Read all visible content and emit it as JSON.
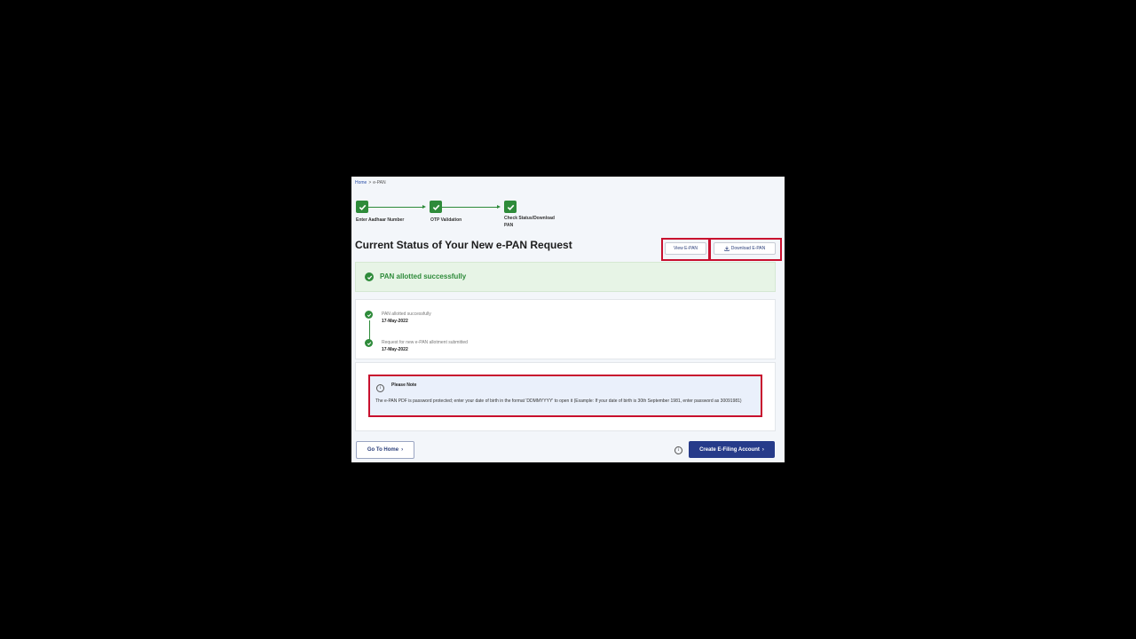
{
  "breadcrumb": {
    "home": "Home",
    "separator": ">",
    "current": "e-PAN"
  },
  "steps": [
    {
      "label": "Enter Aadhaar Number"
    },
    {
      "label": "OTP Validation"
    },
    {
      "label_line1": "Check Status/Download",
      "label_line2": "PAN"
    }
  ],
  "title": "Current Status of Your New e-PAN Request",
  "actions": {
    "view": "View E-PAN",
    "download": "Download E-PAN"
  },
  "status_banner": {
    "message": "PAN allotted successfully"
  },
  "timeline": [
    {
      "text": "PAN allotted successfully",
      "date": "17-May-2022"
    },
    {
      "text": "Request for new e-PAN allotment submitted",
      "date": "17-May-2022"
    }
  ],
  "note": {
    "heading": "Please Note",
    "body": "The e-PAN PDF is password protected; enter your date of birth in the format 'DDMMYYYY' to open it (Example: If your date of birth is 30th September 1981, enter password as 30091981)"
  },
  "footer": {
    "go_home": "Go To Home",
    "create_account": "Create E-Filing Account",
    "chevron": "›",
    "info_glyph": "i"
  },
  "colors": {
    "success": "#2e8b3a",
    "primary": "#263b8a",
    "highlight": "#c8102e"
  }
}
